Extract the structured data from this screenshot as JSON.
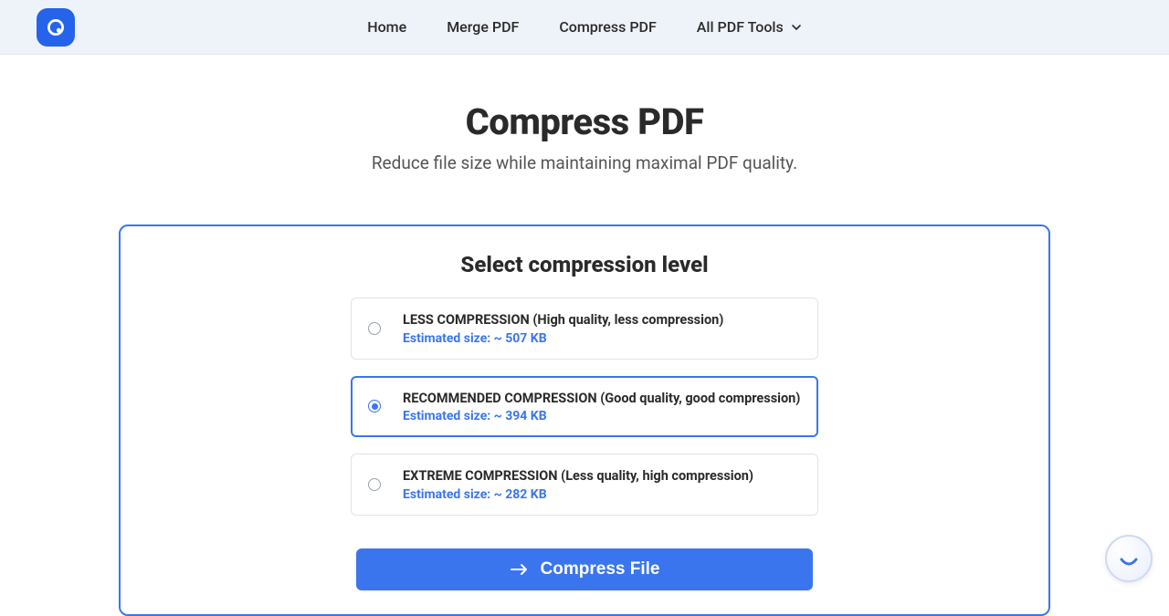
{
  "nav": {
    "home": "Home",
    "merge": "Merge PDF",
    "compress": "Compress PDF",
    "all_tools": "All PDF Tools"
  },
  "header": {
    "title": "Compress PDF",
    "subtitle": "Reduce file size while maintaining maximal PDF quality."
  },
  "panel": {
    "title": "Select compression level",
    "button": "Compress File"
  },
  "options": {
    "less": {
      "title": "LESS COMPRESSION (High quality, less compression)",
      "estimated": "Estimated size: ~ 507 KB"
    },
    "recommended": {
      "title": "RECOMMENDED COMPRESSION (Good quality, good compression)",
      "estimated": "Estimated size: ~ 394 KB"
    },
    "extreme": {
      "title": "EXTREME COMPRESSION (Less quality, high compression)",
      "estimated": "Estimated size: ~ 282 KB"
    }
  }
}
